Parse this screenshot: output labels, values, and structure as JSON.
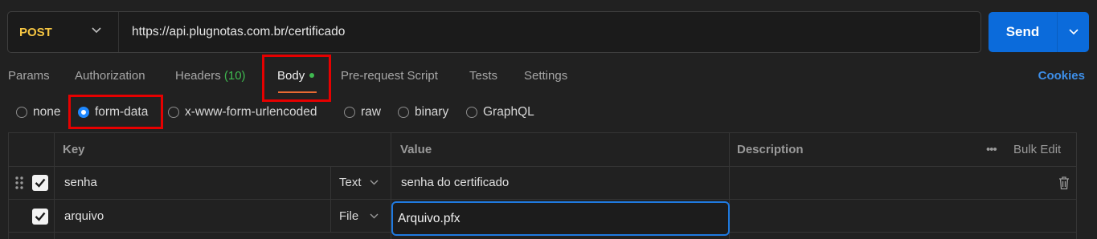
{
  "request": {
    "method": "POST",
    "url": "https://api.plugnotas.com.br/certificado",
    "send_label": "Send"
  },
  "tabs": [
    {
      "label": "Params"
    },
    {
      "label": "Authorization"
    },
    {
      "label": "Headers",
      "count": "(10)"
    },
    {
      "label": "Body",
      "active": true
    },
    {
      "label": "Pre-request Script"
    },
    {
      "label": "Tests"
    },
    {
      "label": "Settings"
    }
  ],
  "cookies_label": "Cookies",
  "body_types": [
    {
      "label": "none"
    },
    {
      "label": "form-data",
      "checked": true
    },
    {
      "label": "x-www-form-urlencoded"
    },
    {
      "label": "raw"
    },
    {
      "label": "binary"
    },
    {
      "label": "GraphQL"
    }
  ],
  "table": {
    "headers": {
      "key": "Key",
      "value": "Value",
      "description": "Description",
      "bulk_edit": "Bulk Edit"
    },
    "rows": [
      {
        "key": "senha",
        "type": "Text",
        "value": "senha do certificado",
        "checked": true
      },
      {
        "key": "arquivo",
        "type": "File",
        "value": "Arquivo.pfx",
        "checked": true
      }
    ]
  },
  "colors": {
    "accent": "#0b6bdb",
    "method": "#f5c542",
    "active_underline": "#e86a33",
    "highlight": "#e60000"
  }
}
